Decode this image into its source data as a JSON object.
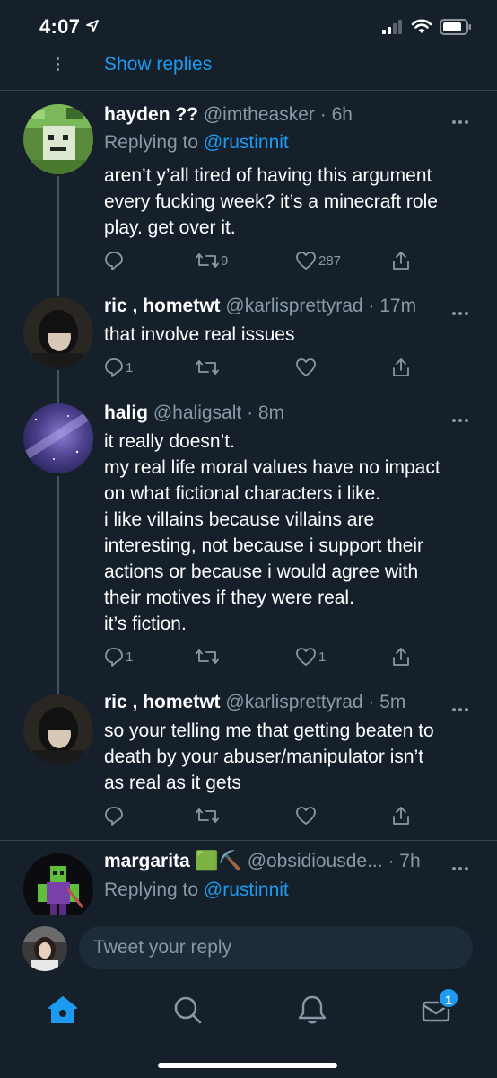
{
  "status_bar": {
    "time": "4:07"
  },
  "thread": {
    "show_replies_label": "Show replies"
  },
  "tweets": [
    {
      "name": "hayden ??",
      "handle": "@imtheasker",
      "time": "6h",
      "replying_prefix": "Replying to",
      "replying_to": "@rustinnit",
      "lines": [
        "aren’t y’all tired of having this argument",
        "every fucking week? it’s a minecraft role",
        "play. get over it."
      ],
      "reply_count": "",
      "retweet_count": "9",
      "like_count": "287"
    },
    {
      "name": "ric , hometwt",
      "handle": "@karlisprettyrad",
      "time": "17m",
      "lines": [
        "that involve real issues"
      ],
      "reply_count": "1",
      "retweet_count": "",
      "like_count": ""
    },
    {
      "name": "halig",
      "handle": "@haligsalt",
      "time": "8m",
      "lines": [
        "it really doesn’t.",
        "my real life moral values have no impact",
        "on what fictional characters i like.",
        "i like villains because villains are",
        "interesting, not because i support their",
        "actions or because i would agree with",
        "their motives if they were real.",
        "it’s fiction."
      ],
      "reply_count": "1",
      "retweet_count": "",
      "like_count": "1"
    },
    {
      "name": "ric , hometwt",
      "handle": "@karlisprettyrad",
      "time": "5m",
      "lines": [
        "so your telling me that getting beaten to",
        "death by your abuser/manipulator isn’t",
        "as real as it gets"
      ],
      "reply_count": "",
      "retweet_count": "",
      "like_count": ""
    },
    {
      "name": "margarita 🟩⛏️",
      "handle": "@obsidiousde...",
      "time": "7h",
      "replying_prefix": "Replying to",
      "replying_to": "@rustinnit"
    }
  ],
  "reply_box": {
    "placeholder": "Tweet your reply"
  },
  "tab_bar": {
    "icons": [
      "home-icon",
      "search-icon",
      "bell-icon",
      "mail-icon"
    ],
    "messages_badge": "1",
    "accent": "#1d9bf0"
  },
  "colors": {
    "background": "#15202b",
    "secondary_text": "#8899a6",
    "link": "#1d9bf0",
    "divider": "#38444d"
  }
}
